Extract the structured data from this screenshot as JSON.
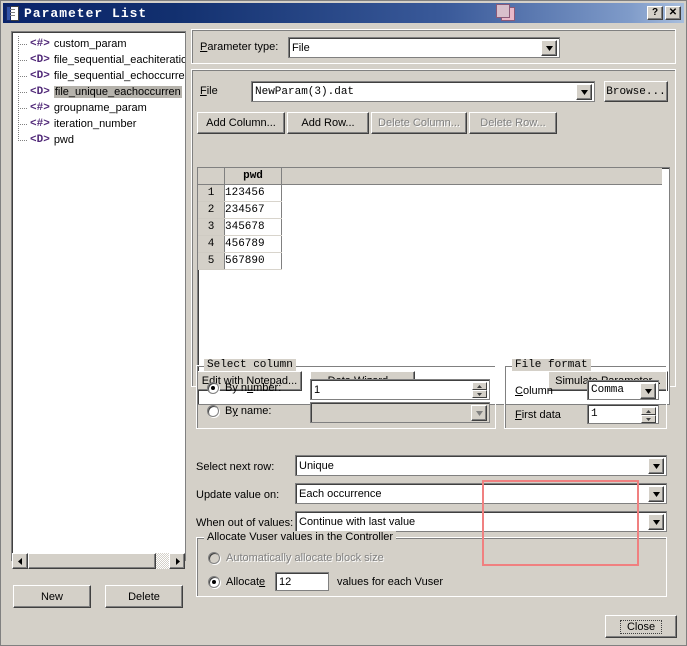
{
  "window": {
    "title": "Parameter List",
    "title_icon": "document-icon",
    "help_button": "?",
    "close_button": "✕",
    "cascade_icon": "cascade-windows-icon"
  },
  "tree": {
    "items": [
      {
        "icon": "<#>",
        "icon_name": "number-param-icon",
        "label": "custom_param",
        "selected": false
      },
      {
        "icon": "<D>",
        "icon_name": "file-param-icon",
        "label": "file_sequential_eachiteratio",
        "selected": false
      },
      {
        "icon": "<D>",
        "icon_name": "file-param-icon",
        "label": "file_sequential_echoccurre",
        "selected": false
      },
      {
        "icon": "<D>",
        "icon_name": "file-param-icon",
        "label": "file_unique_eachoccurren",
        "selected": true
      },
      {
        "icon": "<#>",
        "icon_name": "number-param-icon",
        "label": "groupname_param",
        "selected": false
      },
      {
        "icon": "<#>",
        "icon_name": "number-param-icon",
        "label": "iteration_number",
        "selected": false
      },
      {
        "icon": "<D>",
        "icon_name": "file-param-icon",
        "label": "pwd",
        "selected": false
      }
    ]
  },
  "parameter_type": {
    "label": "Parameter type:",
    "label_accel": "P",
    "value": "File"
  },
  "file_row": {
    "label": "File",
    "label_accel": "F",
    "value": "NewParam(3).dat",
    "browse_label": "Browse..."
  },
  "table_buttons": [
    {
      "label": "Add Column...",
      "accel": "A",
      "disabled": false,
      "name": "add-column-button"
    },
    {
      "label": "Add Row...",
      "accel": "R",
      "disabled": false,
      "name": "add-row-button"
    },
    {
      "label": "Delete Column...",
      "accel": "D",
      "disabled": true,
      "name": "delete-column-button"
    },
    {
      "label": "Delete Row...",
      "accel": "e",
      "disabled": true,
      "name": "delete-row-button"
    }
  ],
  "grid": {
    "columns": [
      "pwd"
    ],
    "row_numbers": [
      "1",
      "2",
      "3",
      "4",
      "5"
    ],
    "rows": [
      [
        "123456"
      ],
      [
        "234567"
      ],
      [
        "345678"
      ],
      [
        "456789"
      ],
      [
        "567890"
      ]
    ]
  },
  "mid_buttons": [
    {
      "label": "Edit with Notepad...",
      "accel": "E",
      "name": "edit-with-notepad-button"
    },
    {
      "label": "Data Wizard...",
      "accel": "W",
      "name": "data-wizard-button"
    },
    {
      "label": "Simulate Parameter...",
      "accel": "S",
      "name": "simulate-parameter-button"
    }
  ],
  "select_column": {
    "caption": "Select column",
    "by_number": {
      "label": "By number:",
      "accel": "n",
      "selected": true,
      "value": "1"
    },
    "by_name": {
      "label": "By name:",
      "accel": "y",
      "selected": false,
      "value": ""
    }
  },
  "file_format": {
    "caption": "File format",
    "column": {
      "label": "Column",
      "accel": "C",
      "value": "Comma"
    },
    "first_data": {
      "label": "First data",
      "accel": "F",
      "value": "1"
    }
  },
  "combos": [
    {
      "label": "Select next row:",
      "accel": "S",
      "value": "Unique",
      "name": "select-next-row"
    },
    {
      "label": "Update value on:",
      "accel": "U",
      "value": "Each occurrence",
      "name": "update-value-on"
    },
    {
      "label": "When out of values:",
      "accel": "h",
      "value": "Continue with last value",
      "name": "when-out-of-values"
    }
  ],
  "highlight": {
    "color": "#f08080"
  },
  "allocate": {
    "caption": "Allocate Vuser values in the Controller",
    "auto": {
      "label": "Automatically allocate block size",
      "selected": false,
      "disabled": true
    },
    "manual": {
      "label_prefix": "Allocate",
      "accel": "e",
      "value": "12",
      "label_suffix": "values for each Vuser",
      "selected": true
    }
  },
  "bottom_buttons": {
    "new": {
      "label": "New",
      "accel": "N"
    },
    "delete": {
      "label": "Delete",
      "accel": "D"
    },
    "close": {
      "label": "Close",
      "accel": "C"
    }
  }
}
